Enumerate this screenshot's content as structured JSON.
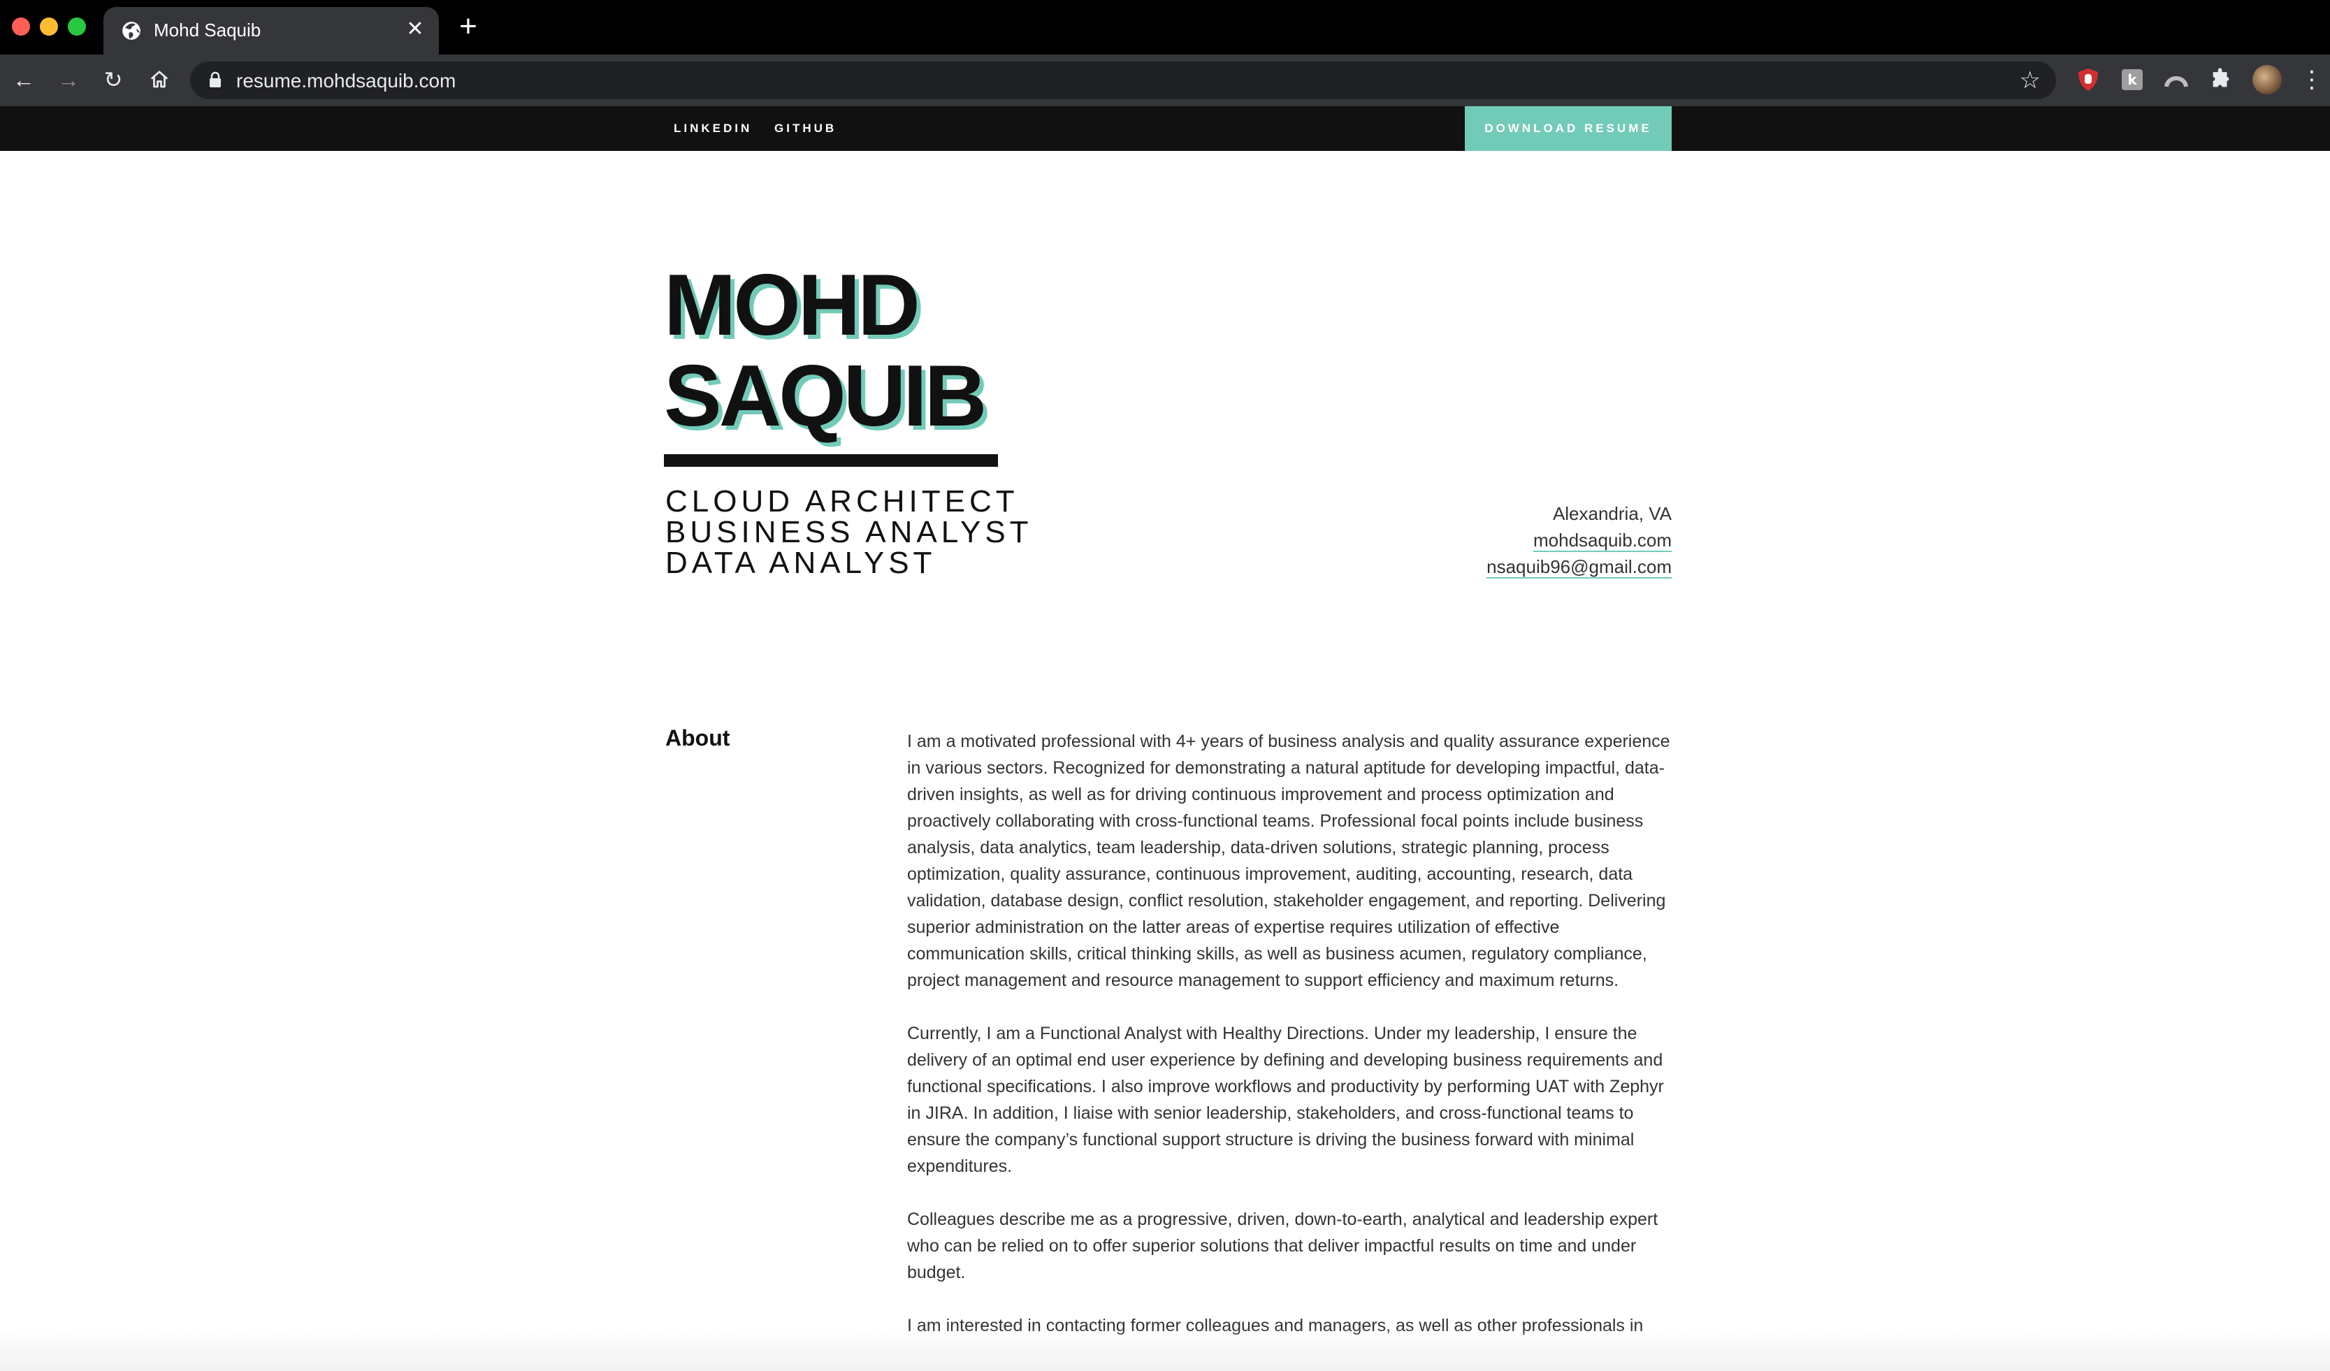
{
  "browser": {
    "tab_title": "Mohd Saquib",
    "url": "resume.mohdsaquib.com",
    "icons": [
      "globe-icon",
      "close-icon",
      "plus-icon",
      "back-icon",
      "forward-icon",
      "reload-icon",
      "home-icon",
      "lock-icon",
      "star-icon",
      "ublock-icon",
      "extension-k-icon",
      "extension-arc-icon",
      "puzzle-icon",
      "profile-avatar",
      "menu-icon"
    ]
  },
  "site_nav": {
    "linkedin": "LINKEDIN",
    "github": "GITHUB",
    "download": "DOWNLOAD RESUME"
  },
  "hero": {
    "name_line1": "MOHD",
    "name_line2": "SAQUIB",
    "roles": [
      "CLOUD ARCHITECT",
      "BUSINESS ANALYST",
      "DATA ANALYST"
    ]
  },
  "contact": {
    "location": "Alexandria, VA",
    "website": "mohdsaquib.com",
    "email": "nsaquib96@gmail.com"
  },
  "about": {
    "heading": "About",
    "paragraphs": [
      "I am a motivated professional with 4+ years of business analysis and quality assurance experience in various sectors. Recognized for demonstrating a natural aptitude for developing impactful, data-driven insights, as well as for driving continuous improvement and process optimization and proactively collaborating with cross-functional teams. Professional focal points include business analysis, data analytics, team leadership, data-driven solutions, strategic planning, process optimization, quality assurance, continuous improvement, auditing, accounting, research, data validation, database design, conflict resolution, stakeholder engagement, and reporting. Delivering superior administration on the latter areas of expertise requires utilization of effective communication skills, critical thinking skills, as well as business acumen, regulatory compliance, project management and resource management to support efficiency and maximum returns.",
      "Currently, I am a Functional Analyst with Healthy Directions. Under my leadership, I ensure the delivery of an optimal end user experience by defining and developing business requirements and functional specifications. I also improve workflows and productivity by performing UAT with Zephyr in JIRA. In addition, I liaise with senior leadership, stakeholders, and cross-functional teams to ensure the company’s functional support structure is driving the business forward with minimal expenditures.",
      "Colleagues describe me as a progressive, driven, down-to-earth, analytical and leadership expert who can be relied on to offer superior solutions that deliver impactful results on time and under budget.",
      "I am interested in contacting former colleagues and managers, as well as other professionals in"
    ]
  },
  "colors": {
    "accent": "#72cbb9",
    "nav_bg": "#111111",
    "chrome_bg": "#35363a"
  }
}
